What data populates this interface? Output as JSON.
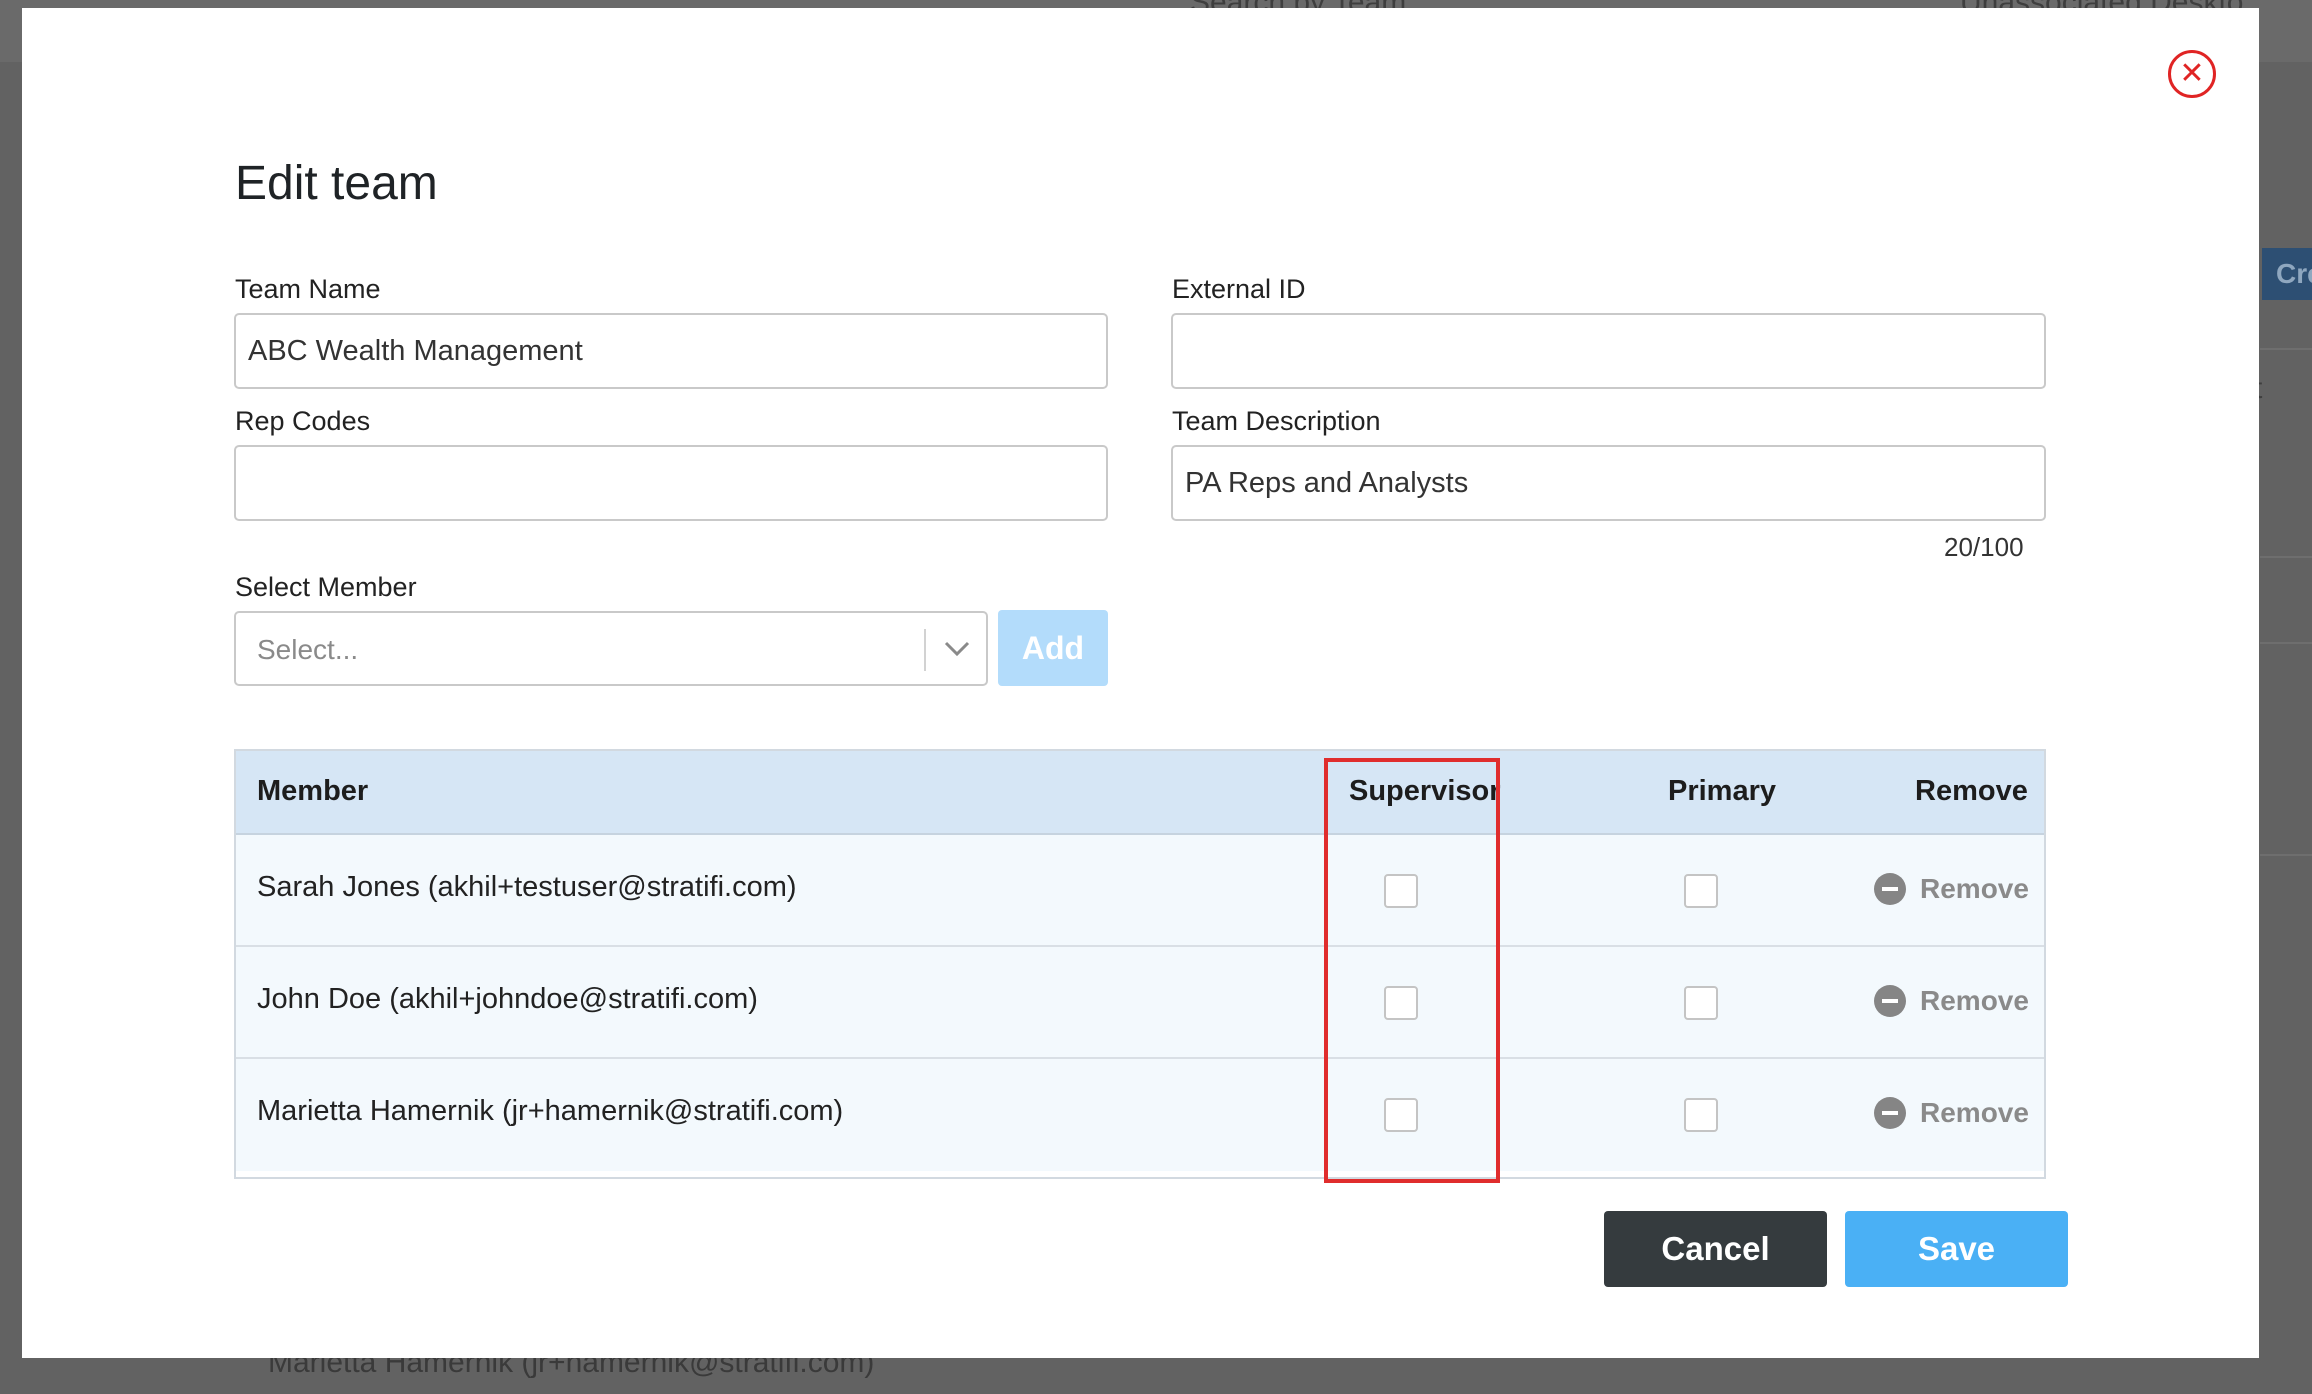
{
  "background": {
    "partial_top_text": "Search by Team",
    "partial_top_right_text": "Unassociated Deskto",
    "partial_create_button": "Cre",
    "partial_row_letter": "t",
    "partial_bottom_row": "Marietta Hamernik (jr+hamernik@stratifi.com)"
  },
  "modal": {
    "title": "Edit team",
    "close_icon": "close-circle-icon",
    "fields": {
      "team_name": {
        "label": "Team Name",
        "value": "ABC Wealth Management"
      },
      "external_id": {
        "label": "External ID",
        "value": ""
      },
      "rep_codes": {
        "label": "Rep Codes",
        "value": ""
      },
      "team_description": {
        "label": "Team Description",
        "value": "PA Reps and Analysts",
        "counter": "20/100"
      }
    },
    "select_member": {
      "label": "Select Member",
      "placeholder": "Select...",
      "add_label": "Add"
    },
    "table": {
      "headers": {
        "member": "Member",
        "supervisor": "Supervisor",
        "primary": "Primary",
        "remove": "Remove"
      },
      "rows": [
        {
          "member": "Sarah Jones (akhil+testuser@stratifi.com)",
          "supervisor": false,
          "primary": false,
          "remove_label": "Remove"
        },
        {
          "member": "John Doe (akhil+johndoe@stratifi.com)",
          "supervisor": false,
          "primary": false,
          "remove_label": "Remove"
        },
        {
          "member": "Marietta Hamernik (jr+hamernik@stratifi.com)",
          "supervisor": false,
          "primary": false,
          "remove_label": "Remove"
        }
      ]
    },
    "actions": {
      "cancel_label": "Cancel",
      "save_label": "Save"
    },
    "colors": {
      "accent": "#4ab0f5",
      "highlight": "#e02d2d",
      "header_bg": "#d6e6f5"
    }
  }
}
